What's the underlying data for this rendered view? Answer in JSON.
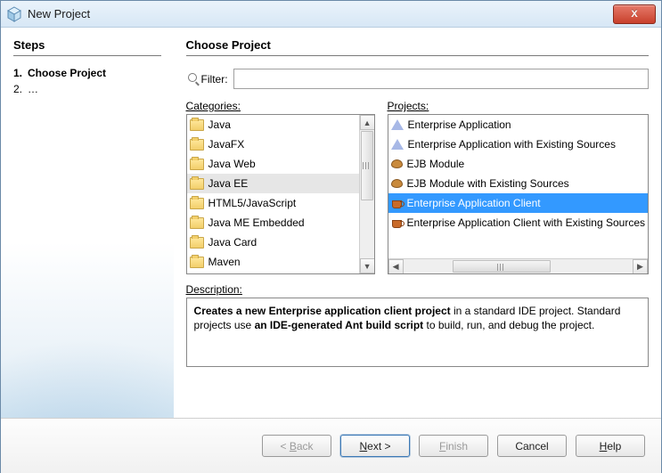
{
  "window": {
    "title": "New Project",
    "close_glyph": "X"
  },
  "steps": {
    "heading": "Steps",
    "items": [
      {
        "num": "1.",
        "label": "Choose Project",
        "current": true
      },
      {
        "num": "2.",
        "label": "…",
        "current": false
      }
    ]
  },
  "main": {
    "heading": "Choose Project",
    "filter_label": "Filter:",
    "filter_value": "",
    "categories_label": "Categories:",
    "projects_label": "Projects:",
    "categories": [
      {
        "label": "Java",
        "icon": "folder"
      },
      {
        "label": "JavaFX",
        "icon": "folder"
      },
      {
        "label": "Java Web",
        "icon": "folder"
      },
      {
        "label": "Java EE",
        "icon": "folder",
        "selected": true
      },
      {
        "label": "HTML5/JavaScript",
        "icon": "folder"
      },
      {
        "label": "Java ME Embedded",
        "icon": "folder"
      },
      {
        "label": "Java Card",
        "icon": "folder"
      },
      {
        "label": "Maven",
        "icon": "folder"
      }
    ],
    "projects": [
      {
        "label": "Enterprise Application",
        "icon": "triangle"
      },
      {
        "label": "Enterprise Application with Existing Sources",
        "icon": "triangle"
      },
      {
        "label": "EJB Module",
        "icon": "bean"
      },
      {
        "label": "EJB Module with Existing Sources",
        "icon": "bean"
      },
      {
        "label": "Enterprise Application Client",
        "icon": "cup",
        "highlighted": true
      },
      {
        "label": "Enterprise Application Client with Existing Sources",
        "icon": "cup"
      }
    ],
    "description_label": "Description:",
    "description": {
      "t1": "Creates a new Enterprise application client project",
      "t2": " in a standard IDE project. Standard projects use ",
      "t3": "an IDE-generated Ant build script",
      "t4": " to build, run, and debug the project."
    }
  },
  "buttons": {
    "back": "< Back",
    "next": "Next >",
    "finish": "Finish",
    "cancel": "Cancel",
    "help": "Help"
  }
}
